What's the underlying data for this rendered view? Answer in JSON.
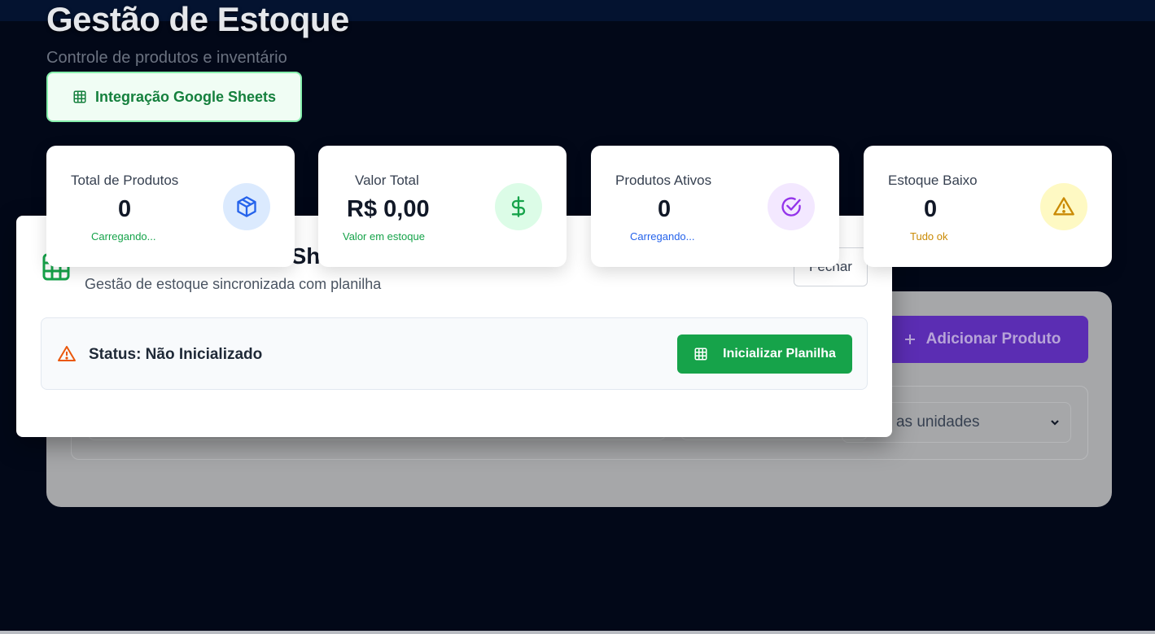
{
  "header": {
    "title": "Gestão de Estoque",
    "subtitle": "Controle de produtos e inventário",
    "integration_button": "Integração Google Sheets"
  },
  "stats": [
    {
      "label": "Total de Produtos",
      "value": "0",
      "sub": "Carregando...",
      "icon": "box-icon",
      "accent": "#2563eb",
      "icon_bg": "#dbeafe",
      "sub_color": "#16a34a"
    },
    {
      "label": "Valor Total",
      "value": "R$ 0,00",
      "sub": "Valor em estoque",
      "icon": "dollar-icon",
      "accent": "#16a34a",
      "icon_bg": "#dcfce7",
      "sub_color": "#16a34a"
    },
    {
      "label": "Produtos Ativos",
      "value": "0",
      "sub": "Carregando...",
      "icon": "check-circle-icon",
      "accent": "#9333ea",
      "icon_bg": "#f3e8ff",
      "sub_color": "#2563eb"
    },
    {
      "label": "Estoque Baixo",
      "value": "0",
      "sub": "Tudo ok",
      "icon": "warning-icon",
      "accent": "#ca8a04",
      "icon_bg": "#fef9c3",
      "sub_color": "#ca8a04"
    }
  ],
  "modal": {
    "title_visible": "Sh",
    "subtitle": "Gestão de estoque sincronizada com planilha",
    "close_label": "Fechar",
    "status_text": "Status: Não Inicializado",
    "init_button": "Inicializar Planilha"
  },
  "main": {
    "add_product_button": "Adicionar Produto",
    "units_select_value": "Todas as unidades"
  },
  "colors": {
    "background": "#020818",
    "modal": "#ffffff",
    "green": "#16a34a",
    "purple": "#5b2db3"
  }
}
